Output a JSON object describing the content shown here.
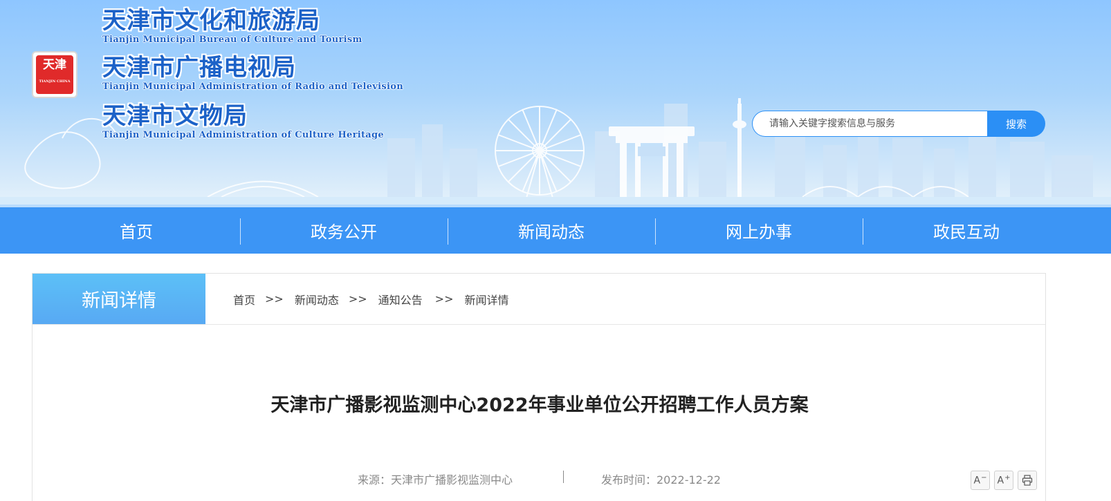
{
  "header": {
    "orgs": [
      {
        "cn": "天津市文化和旅游局",
        "en": "Tianjin Municipal Bureau of Culture and Tourism"
      },
      {
        "cn": "天津市广播电视局",
        "en": "Tianjin Municipal Administration of Radio and Television"
      },
      {
        "cn": "天津市文物局",
        "en": "Tianjin Municipal Administration of Culture Heritage"
      }
    ],
    "seal": {
      "line1": "天津",
      "caption": "TIANJIN CHINA"
    },
    "search": {
      "placeholder": "请输入关键字搜索信息与服务",
      "button": "搜索"
    }
  },
  "nav": {
    "items": [
      "首页",
      "政务公开",
      "新闻动态",
      "网上办事",
      "政民互动"
    ]
  },
  "panel": {
    "tab": "新闻详情",
    "breadcrumb": {
      "items": [
        "首页",
        "新闻动态",
        "通知公告",
        "新闻详情"
      ],
      "separator": ">>"
    }
  },
  "article": {
    "title": "天津市广播影视监测中心2022年事业单位公开招聘工作人员方案",
    "source": "来源：天津市广播影视监测中心",
    "date": "发布时间：2022-12-22"
  },
  "tools": {
    "decrease": "A",
    "increase": "A",
    "print": "print-icon"
  },
  "colors": {
    "nav": "#3c95f5",
    "accent": "#2b8ff5",
    "tab": "#5cc0f7",
    "org_text": "#1c62c8"
  }
}
